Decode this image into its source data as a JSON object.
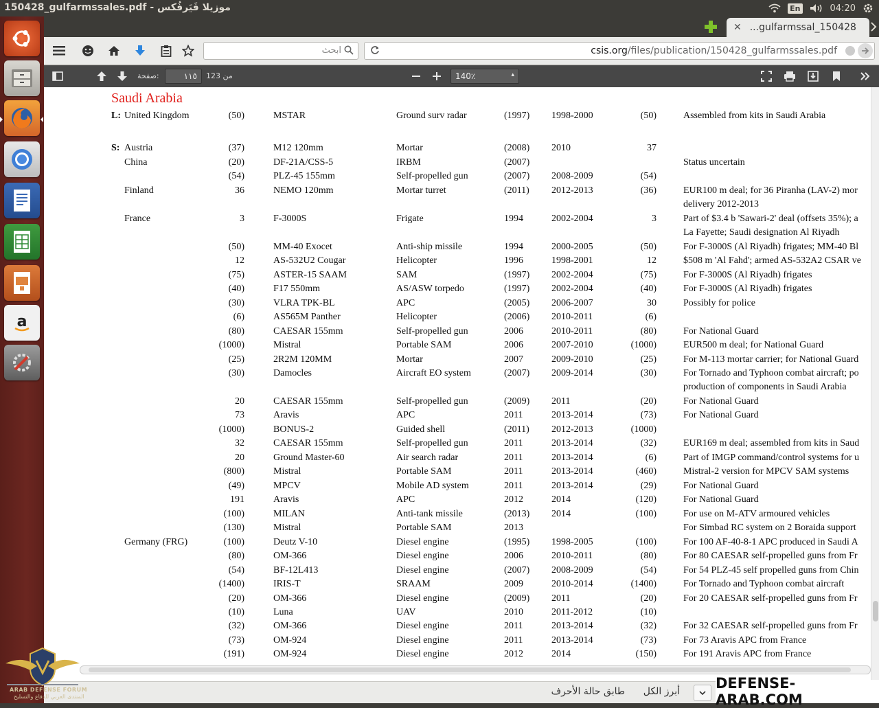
{
  "panel": {
    "window_title": "150428_gulfarmssales.pdf - موزيلا فَيَرفُكس",
    "lang": "En",
    "clock": "04:20"
  },
  "browser": {
    "tab_title": "...gulfarmssal_150428",
    "search_placeholder": "ابحث",
    "url_host": "csis.org",
    "url_path": "/files/publication/150428_gulfarmssales.pdf"
  },
  "pdf_toolbar": {
    "page_label": "صفحة:",
    "page_value": "١١٥",
    "page_count": "من 123",
    "zoom": "140٪"
  },
  "document": {
    "section_title": "Saudi Arabia",
    "rows": [
      {
        "region": "L:",
        "country": "United Kingdom",
        "ordered": "(50)",
        "designation": "MSTAR",
        "desc": "Ground surv radar",
        "year": "(1997)",
        "delyears": "1998-2000",
        "delivered": "(50)",
        "comments": "Assembled from kits in Saudi Arabia"
      },
      {
        "region": "S:",
        "country": "Austria",
        "ordered": "(37)",
        "designation": "M12 120mm",
        "desc": "Mortar",
        "year": "(2008)",
        "delyears": "2010",
        "delivered": "37",
        "comments": ""
      },
      {
        "region": "",
        "country": "China",
        "ordered": "(20)",
        "designation": "DF-21A/CSS-5",
        "desc": "IRBM",
        "year": "(2007)",
        "delyears": "",
        "delivered": "",
        "comments": "Status uncertain"
      },
      {
        "region": "",
        "country": "",
        "ordered": "(54)",
        "designation": "PLZ-45 155mm",
        "desc": "Self-propelled gun",
        "year": "(2007)",
        "delyears": "2008-2009",
        "delivered": "(54)",
        "comments": ""
      },
      {
        "region": "",
        "country": "Finland",
        "ordered": "36",
        "designation": "NEMO 120mm",
        "desc": "Mortar turret",
        "year": "(2011)",
        "delyears": "2012-2013",
        "delivered": "(36)",
        "comments": "EUR100 m deal; for 36 Piranha (LAV-2) mor"
      },
      {
        "region": "",
        "country": "",
        "ordered": "",
        "designation": "",
        "desc": "",
        "year": "",
        "delyears": "",
        "delivered": "",
        "comments": "delivery 2012-2013"
      },
      {
        "region": "",
        "country": "France",
        "ordered": "3",
        "designation": "F-3000S",
        "desc": "Frigate",
        "year": "1994",
        "delyears": "2002-2004",
        "delivered": "3",
        "comments": "Part of $3.4 b 'Sawari-2' deal (offsets 35%); a"
      },
      {
        "region": "",
        "country": "",
        "ordered": "",
        "designation": "",
        "desc": "",
        "year": "",
        "delyears": "",
        "delivered": "",
        "comments": "La Fayette; Saudi designation Al Riyadh"
      },
      {
        "region": "",
        "country": "",
        "ordered": "(50)",
        "designation": "MM-40 Exocet",
        "desc": "Anti-ship missile",
        "year": "1994",
        "delyears": "2000-2005",
        "delivered": "(50)",
        "comments": "For F-3000S (Al Riyadh) frigates; MM-40 Bl"
      },
      {
        "region": "",
        "country": "",
        "ordered": "12",
        "designation": "AS-532U2 Cougar",
        "desc": "Helicopter",
        "year": "1996",
        "delyears": "1998-2001",
        "delivered": "12",
        "comments": "$508 m 'Al Fahd'; armed AS-532A2 CSAR ve"
      },
      {
        "region": "",
        "country": "",
        "ordered": "(75)",
        "designation": "ASTER-15 SAAM",
        "desc": "SAM",
        "year": "(1997)",
        "delyears": "2002-2004",
        "delivered": "(75)",
        "comments": "For F-3000S (Al Riyadh) frigates"
      },
      {
        "region": "",
        "country": "",
        "ordered": "(40)",
        "designation": "F17 550mm",
        "desc": "AS/ASW torpedo",
        "year": "(1997)",
        "delyears": "2002-2004",
        "delivered": "(40)",
        "comments": "For F-3000S (Al Riyadh) frigates"
      },
      {
        "region": "",
        "country": "",
        "ordered": "(30)",
        "designation": "VLRA TPK-BL",
        "desc": "APC",
        "year": "(2005)",
        "delyears": "2006-2007",
        "delivered": "30",
        "comments": "Possibly for police"
      },
      {
        "region": "",
        "country": "",
        "ordered": "(6)",
        "designation": "AS565M Panther",
        "desc": "Helicopter",
        "year": "(2006)",
        "delyears": "2010-2011",
        "delivered": "(6)",
        "comments": ""
      },
      {
        "region": "",
        "country": "",
        "ordered": "(80)",
        "designation": "CAESAR 155mm",
        "desc": "Self-propelled gun",
        "year": "2006",
        "delyears": "2010-2011",
        "delivered": "(80)",
        "comments": "For National Guard"
      },
      {
        "region": "",
        "country": "",
        "ordered": "(1000)",
        "designation": "Mistral",
        "desc": "Portable SAM",
        "year": "2006",
        "delyears": "2007-2010",
        "delivered": "(1000)",
        "comments": "EUR500 m deal; for National Guard"
      },
      {
        "region": "",
        "country": "",
        "ordered": "(25)",
        "designation": "2R2M 120MM",
        "desc": "Mortar",
        "year": "2007",
        "delyears": "2009-2010",
        "delivered": "(25)",
        "comments": "For M-113 mortar carrier; for National Guard"
      },
      {
        "region": "",
        "country": "",
        "ordered": "(30)",
        "designation": "Damocles",
        "desc": "Aircraft EO system",
        "year": "(2007)",
        "delyears": "2009-2014",
        "delivered": "(30)",
        "comments": "For Tornado and Typhoon combat aircraft; po"
      },
      {
        "region": "",
        "country": "",
        "ordered": "",
        "designation": "",
        "desc": "",
        "year": "",
        "delyears": "",
        "delivered": "",
        "comments": "production of components in Saudi Arabia"
      },
      {
        "region": "",
        "country": "",
        "ordered": "20",
        "designation": "CAESAR 155mm",
        "desc": "Self-propelled gun",
        "year": "(2009)",
        "delyears": "2011",
        "delivered": "(20)",
        "comments": "For National Guard"
      },
      {
        "region": "",
        "country": "",
        "ordered": "73",
        "designation": "Aravis",
        "desc": "APC",
        "year": "2011",
        "delyears": "2013-2014",
        "delivered": "(73)",
        "comments": "For National Guard"
      },
      {
        "region": "",
        "country": "",
        "ordered": "(1000)",
        "designation": "BONUS-2",
        "desc": "Guided shell",
        "year": "(2011)",
        "delyears": "2012-2013",
        "delivered": "(1000)",
        "comments": ""
      },
      {
        "region": "",
        "country": "",
        "ordered": "32",
        "designation": "CAESAR 155mm",
        "desc": "Self-propelled gun",
        "year": "2011",
        "delyears": "2013-2014",
        "delivered": "(32)",
        "comments": "EUR169 m deal; assembled from kits in Saud"
      },
      {
        "region": "",
        "country": "",
        "ordered": "20",
        "designation": "Ground Master-60",
        "desc": "Air search radar",
        "year": "2011",
        "delyears": "2013-2014",
        "delivered": "(6)",
        "comments": "Part of IMGP command/control systems for u"
      },
      {
        "region": "",
        "country": "",
        "ordered": "(800)",
        "designation": "Mistral",
        "desc": "Portable SAM",
        "year": "2011",
        "delyears": "2013-2014",
        "delivered": "(460)",
        "comments": "Mistral-2 version for MPCV SAM systems"
      },
      {
        "region": "",
        "country": "",
        "ordered": "(49)",
        "designation": "MPCV",
        "desc": "Mobile AD system",
        "year": "2011",
        "delyears": "2013-2014",
        "delivered": "(29)",
        "comments": "For National Guard"
      },
      {
        "region": "",
        "country": "",
        "ordered": "191",
        "designation": "Aravis",
        "desc": "APC",
        "year": "2012",
        "delyears": "2014",
        "delivered": "(120)",
        "comments": "For National Guard"
      },
      {
        "region": "",
        "country": "",
        "ordered": "(100)",
        "designation": "MILAN",
        "desc": "Anti-tank missile",
        "year": "(2013)",
        "delyears": "2014",
        "delivered": "(100)",
        "comments": "For use on M-ATV armoured vehicles"
      },
      {
        "region": "",
        "country": "",
        "ordered": "(130)",
        "designation": "Mistral",
        "desc": "Portable SAM",
        "year": "2013",
        "delyears": "",
        "delivered": "",
        "comments": "For Simbad RC system on 2 Boraida support"
      },
      {
        "region": "",
        "country": "Germany (FRG)",
        "ordered": "(100)",
        "designation": "Deutz V-10",
        "desc": "Diesel engine",
        "year": "(1995)",
        "delyears": "1998-2005",
        "delivered": "(100)",
        "comments": "For 100 AF-40-8-1 APC produced in Saudi A"
      },
      {
        "region": "",
        "country": "",
        "ordered": "(80)",
        "designation": "OM-366",
        "desc": "Diesel engine",
        "year": "2006",
        "delyears": "2010-2011",
        "delivered": "(80)",
        "comments": "For 80 CAESAR self-propelled guns from Fr"
      },
      {
        "region": "",
        "country": "",
        "ordered": "(54)",
        "designation": "BF-12L413",
        "desc": "Diesel engine",
        "year": "(2007)",
        "delyears": "2008-2009",
        "delivered": "(54)",
        "comments": "For 54 PLZ-45 self propelled guns from Chin"
      },
      {
        "region": "",
        "country": "",
        "ordered": "(1400)",
        "designation": "IRIS-T",
        "desc": "SRAAM",
        "year": "2009",
        "delyears": "2010-2014",
        "delivered": "(1400)",
        "comments": "For Tornado and Typhoon combat aircraft"
      },
      {
        "region": "",
        "country": "",
        "ordered": "(20)",
        "designation": "OM-366",
        "desc": "Diesel engine",
        "year": "(2009)",
        "delyears": "2011",
        "delivered": "(20)",
        "comments": "For 20 CAESAR self-propelled guns from Fr"
      },
      {
        "region": "",
        "country": "",
        "ordered": "(10)",
        "designation": "Luna",
        "desc": "UAV",
        "year": "2010",
        "delyears": "2011-2012",
        "delivered": "(10)",
        "comments": ""
      },
      {
        "region": "",
        "country": "",
        "ordered": "(32)",
        "designation": "OM-366",
        "desc": "Diesel engine",
        "year": "2011",
        "delyears": "2013-2014",
        "delivered": "(32)",
        "comments": "For 32 CAESAR self-propelled guns from Fr"
      },
      {
        "region": "",
        "country": "",
        "ordered": "(73)",
        "designation": "OM-924",
        "desc": "Diesel engine",
        "year": "2011",
        "delyears": "2013-2014",
        "delivered": "(73)",
        "comments": "For 73 Aravis APC from France"
      },
      {
        "region": "",
        "country": "",
        "ordered": "(191)",
        "designation": "OM-924",
        "desc": "Diesel engine",
        "year": "2012",
        "delyears": "2014",
        "delivered": "(150)",
        "comments": "For 191 Aravis APC from France"
      }
    ]
  },
  "findbar": {
    "highlight_all": "أبرز الكل",
    "match_case": "طابق حالة الأحرف"
  },
  "watermark": {
    "site": "DEFENSE-ARAB.COM",
    "logo_text": "ARAB DEFENSE FORUM",
    "logo_subtext": "المنتدى العربي للدفاع والتسليح"
  }
}
